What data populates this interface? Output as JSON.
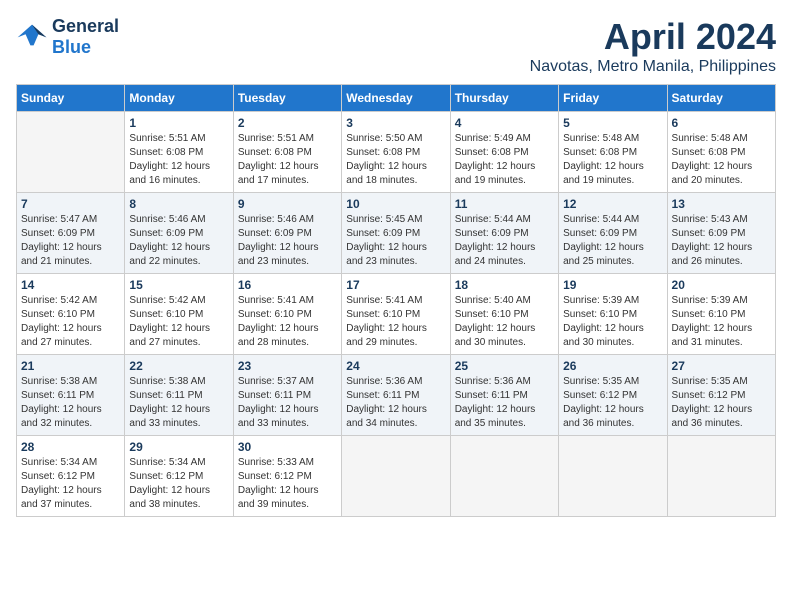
{
  "logo": {
    "line1": "General",
    "line2": "Blue"
  },
  "title": "April 2024",
  "subtitle": "Navotas, Metro Manila, Philippines",
  "days_of_week": [
    "Sunday",
    "Monday",
    "Tuesday",
    "Wednesday",
    "Thursday",
    "Friday",
    "Saturday"
  ],
  "weeks": [
    [
      {
        "day": "",
        "info": ""
      },
      {
        "day": "1",
        "info": "Sunrise: 5:51 AM\nSunset: 6:08 PM\nDaylight: 12 hours\nand 16 minutes."
      },
      {
        "day": "2",
        "info": "Sunrise: 5:51 AM\nSunset: 6:08 PM\nDaylight: 12 hours\nand 17 minutes."
      },
      {
        "day": "3",
        "info": "Sunrise: 5:50 AM\nSunset: 6:08 PM\nDaylight: 12 hours\nand 18 minutes."
      },
      {
        "day": "4",
        "info": "Sunrise: 5:49 AM\nSunset: 6:08 PM\nDaylight: 12 hours\nand 19 minutes."
      },
      {
        "day": "5",
        "info": "Sunrise: 5:48 AM\nSunset: 6:08 PM\nDaylight: 12 hours\nand 19 minutes."
      },
      {
        "day": "6",
        "info": "Sunrise: 5:48 AM\nSunset: 6:08 PM\nDaylight: 12 hours\nand 20 minutes."
      }
    ],
    [
      {
        "day": "7",
        "info": "Sunrise: 5:47 AM\nSunset: 6:09 PM\nDaylight: 12 hours\nand 21 minutes."
      },
      {
        "day": "8",
        "info": "Sunrise: 5:46 AM\nSunset: 6:09 PM\nDaylight: 12 hours\nand 22 minutes."
      },
      {
        "day": "9",
        "info": "Sunrise: 5:46 AM\nSunset: 6:09 PM\nDaylight: 12 hours\nand 23 minutes."
      },
      {
        "day": "10",
        "info": "Sunrise: 5:45 AM\nSunset: 6:09 PM\nDaylight: 12 hours\nand 23 minutes."
      },
      {
        "day": "11",
        "info": "Sunrise: 5:44 AM\nSunset: 6:09 PM\nDaylight: 12 hours\nand 24 minutes."
      },
      {
        "day": "12",
        "info": "Sunrise: 5:44 AM\nSunset: 6:09 PM\nDaylight: 12 hours\nand 25 minutes."
      },
      {
        "day": "13",
        "info": "Sunrise: 5:43 AM\nSunset: 6:09 PM\nDaylight: 12 hours\nand 26 minutes."
      }
    ],
    [
      {
        "day": "14",
        "info": "Sunrise: 5:42 AM\nSunset: 6:10 PM\nDaylight: 12 hours\nand 27 minutes."
      },
      {
        "day": "15",
        "info": "Sunrise: 5:42 AM\nSunset: 6:10 PM\nDaylight: 12 hours\nand 27 minutes."
      },
      {
        "day": "16",
        "info": "Sunrise: 5:41 AM\nSunset: 6:10 PM\nDaylight: 12 hours\nand 28 minutes."
      },
      {
        "day": "17",
        "info": "Sunrise: 5:41 AM\nSunset: 6:10 PM\nDaylight: 12 hours\nand 29 minutes."
      },
      {
        "day": "18",
        "info": "Sunrise: 5:40 AM\nSunset: 6:10 PM\nDaylight: 12 hours\nand 30 minutes."
      },
      {
        "day": "19",
        "info": "Sunrise: 5:39 AM\nSunset: 6:10 PM\nDaylight: 12 hours\nand 30 minutes."
      },
      {
        "day": "20",
        "info": "Sunrise: 5:39 AM\nSunset: 6:10 PM\nDaylight: 12 hours\nand 31 minutes."
      }
    ],
    [
      {
        "day": "21",
        "info": "Sunrise: 5:38 AM\nSunset: 6:11 PM\nDaylight: 12 hours\nand 32 minutes."
      },
      {
        "day": "22",
        "info": "Sunrise: 5:38 AM\nSunset: 6:11 PM\nDaylight: 12 hours\nand 33 minutes."
      },
      {
        "day": "23",
        "info": "Sunrise: 5:37 AM\nSunset: 6:11 PM\nDaylight: 12 hours\nand 33 minutes."
      },
      {
        "day": "24",
        "info": "Sunrise: 5:36 AM\nSunset: 6:11 PM\nDaylight: 12 hours\nand 34 minutes."
      },
      {
        "day": "25",
        "info": "Sunrise: 5:36 AM\nSunset: 6:11 PM\nDaylight: 12 hours\nand 35 minutes."
      },
      {
        "day": "26",
        "info": "Sunrise: 5:35 AM\nSunset: 6:12 PM\nDaylight: 12 hours\nand 36 minutes."
      },
      {
        "day": "27",
        "info": "Sunrise: 5:35 AM\nSunset: 6:12 PM\nDaylight: 12 hours\nand 36 minutes."
      }
    ],
    [
      {
        "day": "28",
        "info": "Sunrise: 5:34 AM\nSunset: 6:12 PM\nDaylight: 12 hours\nand 37 minutes."
      },
      {
        "day": "29",
        "info": "Sunrise: 5:34 AM\nSunset: 6:12 PM\nDaylight: 12 hours\nand 38 minutes."
      },
      {
        "day": "30",
        "info": "Sunrise: 5:33 AM\nSunset: 6:12 PM\nDaylight: 12 hours\nand 39 minutes."
      },
      {
        "day": "",
        "info": ""
      },
      {
        "day": "",
        "info": ""
      },
      {
        "day": "",
        "info": ""
      },
      {
        "day": "",
        "info": ""
      }
    ]
  ]
}
